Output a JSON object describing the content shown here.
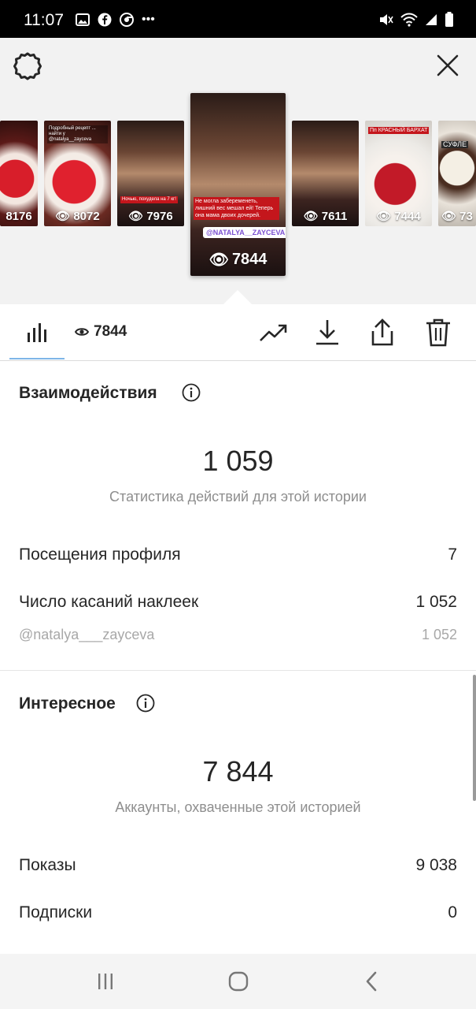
{
  "status_bar": {
    "time": "11:07"
  },
  "thumbnails": [
    {
      "views": "8176",
      "caption": ""
    },
    {
      "views": "8072",
      "caption": "Подробный рецепт ... найти у @natalya__zayceva"
    },
    {
      "views": "7976",
      "caption": "Ночью, похудела на 7 кг!"
    },
    {
      "views": "7844",
      "caption": "Не могла забеременеть, лишний вес мешал ей! Теперь она мама двоих дочерей.",
      "sticker": "@NATALYA__ZAYCEVA",
      "selected": true
    },
    {
      "views": "7611",
      "caption": ""
    },
    {
      "views": "7444",
      "caption": "Пп КРАСНЫЙ БАРХАТ"
    },
    {
      "views": "73",
      "caption": "СУФЛЕ"
    }
  ],
  "tabs": {
    "views_count": "7844"
  },
  "interactions": {
    "title": "Взаимодействия",
    "total": "1 059",
    "subtitle": "Статистика действий для этой истории",
    "rows": [
      {
        "label": "Посещения профиля",
        "value": "7"
      },
      {
        "label": "Число касаний наклеек",
        "value": "1 052"
      },
      {
        "label": "@natalya___zayceva",
        "value": "1 052"
      }
    ]
  },
  "discovery": {
    "title": "Интересное",
    "total": "7 844",
    "subtitle": "Аккаунты, охваченные этой историей",
    "rows": [
      {
        "label": "Показы",
        "value": "9 038"
      },
      {
        "label": "Подписки",
        "value": "0"
      }
    ]
  },
  "colors": {
    "accent_underline": "#7fb6e8",
    "status_bar": "#000000"
  }
}
